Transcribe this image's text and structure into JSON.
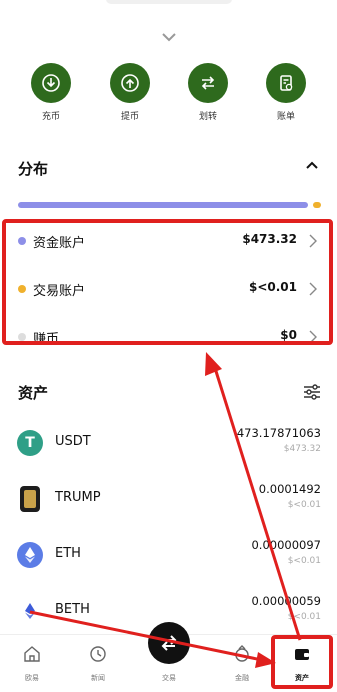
{
  "actions": [
    {
      "label": "充币",
      "icon": "deposit-icon"
    },
    {
      "label": "提币",
      "icon": "withdraw-icon"
    },
    {
      "label": "划转",
      "icon": "transfer-icon"
    },
    {
      "label": "账单",
      "icon": "bill-icon"
    }
  ],
  "distribution": {
    "title": "分布",
    "bar_share": 0.97,
    "rows": [
      {
        "name": "资金账户",
        "amount": "$473.32",
        "color": "#8d8fe8"
      },
      {
        "name": "交易账户",
        "amount": "$<0.01",
        "color": "#f0b12d"
      },
      {
        "name": "赚币",
        "amount": "$0",
        "color": "#dddddd"
      }
    ]
  },
  "assets": {
    "title": "资产",
    "items": [
      {
        "symbol": "USDT",
        "quantity": "473.17871063",
        "value": "$473.32",
        "color": "#2f9f87",
        "icon": "usdt-icon"
      },
      {
        "symbol": "TRUMP",
        "quantity": "0.0001492",
        "value": "$<0.01",
        "color": "#1d1d1d",
        "icon": "trump-icon"
      },
      {
        "symbol": "ETH",
        "quantity": "0.00000097",
        "value": "$<0.01",
        "color": "#5b7ce6",
        "icon": "eth-icon"
      },
      {
        "symbol": "BETH",
        "quantity": "0.00000059",
        "value": "$<0.01",
        "color": "#ffffff",
        "icon": "beth-icon"
      }
    ]
  },
  "tabs": [
    {
      "label": "欧易",
      "icon": "home-icon"
    },
    {
      "label": "新闻",
      "icon": "news-icon"
    },
    {
      "label": "交易",
      "icon": "trade-icon"
    },
    {
      "label": "金融",
      "icon": "finance-icon"
    },
    {
      "label": "资产",
      "icon": "wallet-icon"
    }
  ],
  "colors": {
    "accent": "#2e6a1d",
    "annotation": "#e0201e"
  }
}
